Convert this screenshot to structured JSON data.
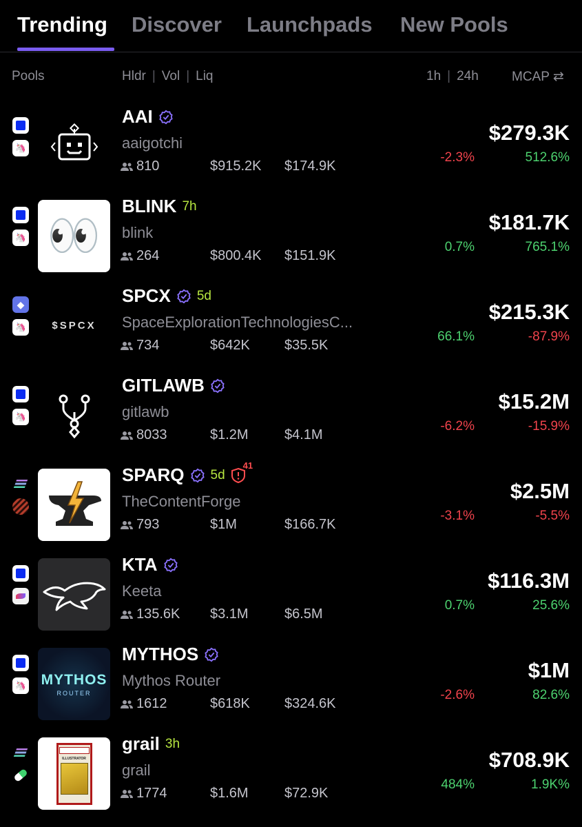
{
  "tabs": [
    "Trending",
    "Discover",
    "Launchpads",
    "New Pools"
  ],
  "columns": {
    "pools": "Pools",
    "holders": "Hldr",
    "volume": "Vol",
    "liquidity": "Liq",
    "h1": "1h",
    "h24": "24h",
    "mcap": "MCAP",
    "swap_icon": "⇄"
  },
  "colors": {
    "accent": "#7a5cf0",
    "positive": "#4dd26f",
    "negative": "#f0434c",
    "age": "#b7e640"
  },
  "rows": [
    {
      "symbol": "AAI",
      "name": "aaigotchi",
      "age": "",
      "verified": true,
      "risk": "",
      "holders": "810",
      "volume": "$915.2K",
      "liquidity": "$174.9K",
      "mcap": "$279.3K",
      "change_1h": "-2.3%",
      "change_24h": "512.6%",
      "chains": [
        "base-icon",
        "uniswap-icon"
      ],
      "avatar_icon": "robot-icon"
    },
    {
      "symbol": "BLINK",
      "name": "blink",
      "age": "7h",
      "verified": false,
      "risk": "",
      "holders": "264",
      "volume": "$800.4K",
      "liquidity": "$151.9K",
      "mcap": "$181.7K",
      "change_1h": "0.7%",
      "change_24h": "765.1%",
      "chains": [
        "base-icon",
        "uniswap-icon"
      ],
      "avatar_icon": "eyes-icon",
      "avatar_glyph": "👀"
    },
    {
      "symbol": "SPCX",
      "name": "SpaceExplorationTechnologiesC...",
      "age": "5d",
      "verified": true,
      "risk": "",
      "holders": "734",
      "volume": "$642K",
      "liquidity": "$35.5K",
      "mcap": "$215.3K",
      "change_1h": "66.1%",
      "change_24h": "-87.9%",
      "chains": [
        "ethereum-icon",
        "uniswap-icon"
      ],
      "avatar_icon": "spcx-logo-icon",
      "avatar_text": "$SPCX"
    },
    {
      "symbol": "GITLAWB",
      "name": "gitlawb",
      "age": "",
      "verified": true,
      "risk": "",
      "holders": "8033",
      "volume": "$1.2M",
      "liquidity": "$4.1M",
      "mcap": "$15.2M",
      "change_1h": "-6.2%",
      "change_24h": "-15.9%",
      "chains": [
        "base-icon",
        "uniswap-icon"
      ],
      "avatar_icon": "git-branch-icon"
    },
    {
      "symbol": "SPARQ",
      "name": "TheContentForge",
      "age": "5d",
      "verified": true,
      "risk": "41",
      "holders": "793",
      "volume": "$1M",
      "liquidity": "$166.7K",
      "mcap": "$2.5M",
      "change_1h": "-3.1%",
      "change_24h": "-5.5%",
      "chains": [
        "solana-icon",
        "striped-dex-icon"
      ],
      "avatar_icon": "anvil-lightning-icon"
    },
    {
      "symbol": "KTA",
      "name": "Keeta",
      "age": "",
      "verified": true,
      "risk": "",
      "holders": "135.6K",
      "volume": "$3.1M",
      "liquidity": "$6.5M",
      "mcap": "$116.3M",
      "change_1h": "0.7%",
      "change_24h": "25.6%",
      "chains": [
        "base-icon",
        "keeta-icon"
      ],
      "avatar_icon": "keeta-animal-icon"
    },
    {
      "symbol": "MYTHOS",
      "name": "Mythos Router",
      "age": "",
      "verified": true,
      "risk": "",
      "holders": "1612",
      "volume": "$618K",
      "liquidity": "$324.6K",
      "mcap": "$1M",
      "change_1h": "-2.6%",
      "change_24h": "82.6%",
      "chains": [
        "base-icon",
        "uniswap-icon"
      ],
      "avatar_icon": "mythos-logo-icon",
      "avatar_text": "MYTHOS",
      "avatar_subtext": "ROUTER"
    },
    {
      "symbol": "grail",
      "name": "grail",
      "age": "3h",
      "verified": false,
      "risk": "",
      "holders": "1774",
      "volume": "$1.6M",
      "liquidity": "$72.9K",
      "mcap": "$708.9K",
      "change_1h": "484%",
      "change_24h": "1.9K%",
      "chains": [
        "solana-icon",
        "pill-icon"
      ],
      "avatar_icon": "graded-card-icon",
      "avatar_text": "ILLUSTRATOR"
    }
  ]
}
